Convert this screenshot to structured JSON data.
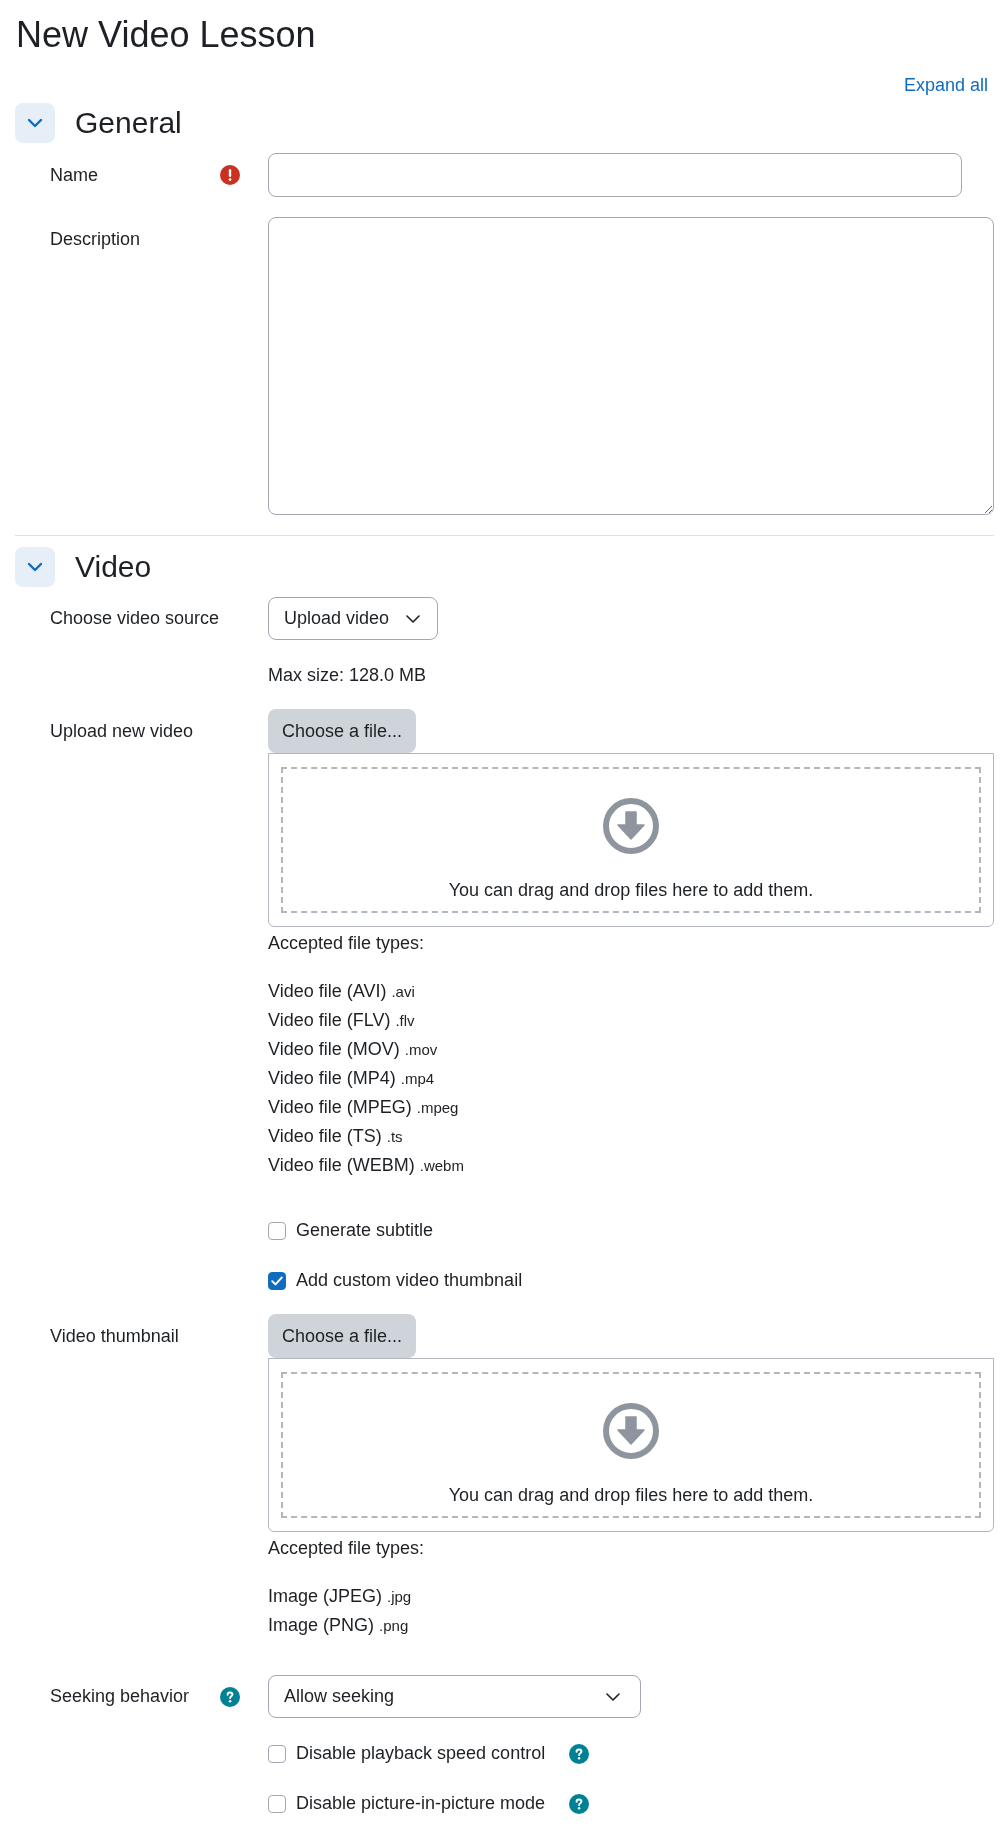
{
  "page": {
    "title": "New Video Lesson",
    "expand_link": "Expand all"
  },
  "sections": [
    {
      "title": "General",
      "expanded": true,
      "fields": [
        {
          "kind": "text",
          "label": "Name",
          "required": true,
          "help": false
        },
        {
          "kind": "textarea",
          "label": "Description",
          "required": false,
          "help": false
        }
      ]
    },
    {
      "title": "Video",
      "expanded": true,
      "fields": [
        {
          "kind": "select",
          "label": "Choose video source",
          "required": false,
          "help": false,
          "value": "Upload video"
        },
        {
          "kind": "note",
          "text": "Max size: 128.0 MB"
        },
        {
          "kind": "filepicker",
          "label": "Upload new video",
          "required": false,
          "help": false,
          "button": "Choose a file...",
          "drop_text": "You can drag and drop files here to add them.",
          "accepted_label": "Accepted file types:",
          "file_types": [
            {
              "name": "Video file (AVI)",
              "extension": ".avi"
            },
            {
              "name": "Video file (FLV)",
              "extension": ".flv"
            },
            {
              "name": "Video file (MOV)",
              "extension": ".mov"
            },
            {
              "name": "Video file (MP4)",
              "extension": ".mp4"
            },
            {
              "name": "Video file (MPEG)",
              "extension": ".mpeg"
            },
            {
              "name": "Video file (TS)",
              "extension": ".ts"
            },
            {
              "name": "Video file (WEBM)",
              "extension": ".webm"
            }
          ]
        },
        {
          "kind": "checkbox",
          "text": "Generate subtitle",
          "checked": false,
          "help": false
        },
        {
          "kind": "checkbox",
          "text": "Add custom video thumbnail",
          "checked": true,
          "help": false
        },
        {
          "kind": "filepicker",
          "label": "Video thumbnail",
          "required": false,
          "help": false,
          "button": "Choose a file...",
          "drop_text": "You can drag and drop files here to add them.",
          "accepted_label": "Accepted file types:",
          "file_types": [
            {
              "name": "Image (JPEG)",
              "extension": ".jpg"
            },
            {
              "name": "Image (PNG)",
              "extension": ".png"
            }
          ]
        },
        {
          "kind": "select",
          "label": "Seeking behavior",
          "required": false,
          "help": true,
          "value": "Allow seeking"
        },
        {
          "kind": "checkbox",
          "text": "Disable playback speed control",
          "checked": false,
          "help": true
        },
        {
          "kind": "checkbox",
          "text": "Disable picture-in-picture mode",
          "checked": false,
          "help": true
        }
      ]
    }
  ]
}
